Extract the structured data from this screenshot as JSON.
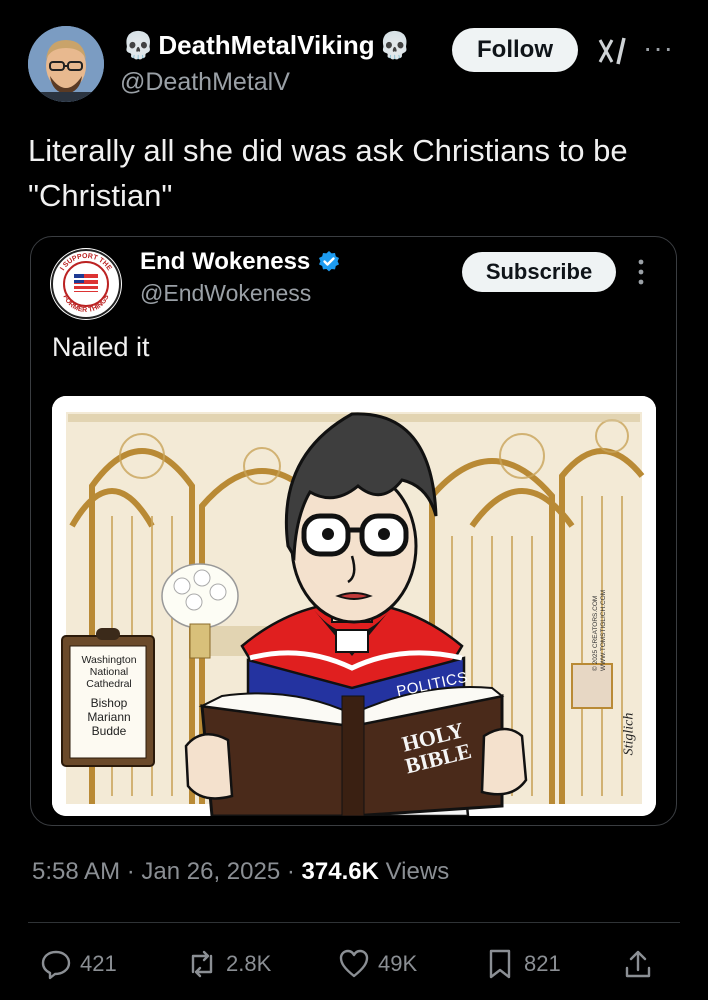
{
  "author": {
    "name": "DeathMetalViking",
    "handle": "@DeathMetalV",
    "follow_label": "Follow",
    "name_prefix_icon": "skull-icon",
    "name_suffix_icon": "skull-icon"
  },
  "tweet": {
    "text": "Literally all she did was ask Christians to be\n\"Christian\""
  },
  "quoted_post": {
    "name": "End Wokeness",
    "handle": "@EndWokeness",
    "subscribe_label": "Subscribe",
    "text": "Nailed it",
    "verified": true,
    "avatar_text_top": "I SUPPORT THE",
    "avatar_text_bottom": "FORMER THINGS"
  },
  "cartoon": {
    "plaque_line1": "Washington\nNational\nCathedral",
    "plaque_line2": "Bishop\nMariann\nBudde",
    "politics_label": "POLITICS",
    "bible_label": "HOLY\nBIBLE",
    "signature": "Stiglich",
    "copyright": "© 2025 CREATORS.COM WWW.TOMSTIGLICH.COM"
  },
  "meta": {
    "time": "5:58 AM",
    "date": "Jan 26, 2025",
    "views_count": "374.6K",
    "views_label": "Views"
  },
  "actions": {
    "replies": "421",
    "reposts": "2.8K",
    "likes": "49K",
    "bookmarks": "821"
  },
  "colors": {
    "background": "#000000",
    "verified_blue": "#1d9bf0",
    "muted_text": "#8b8f94"
  }
}
